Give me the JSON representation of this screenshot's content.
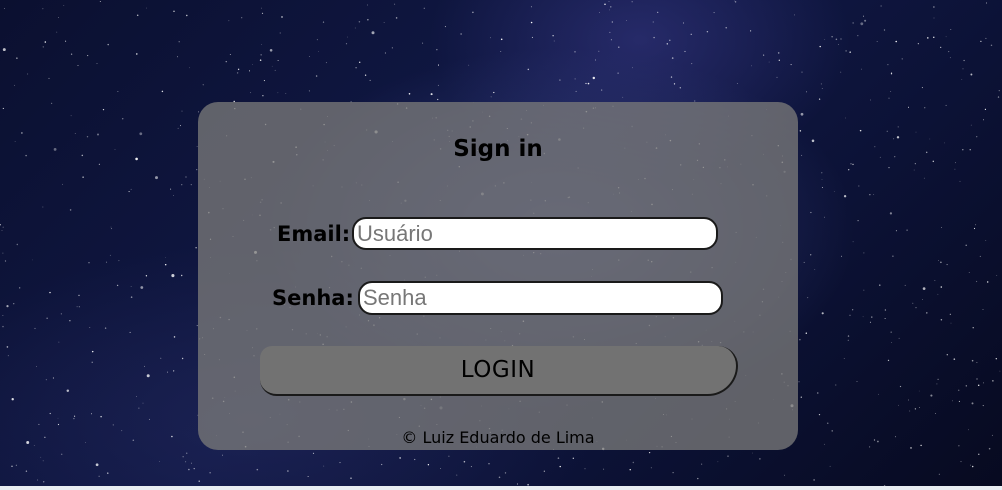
{
  "form": {
    "title": "Sign in",
    "email_label": "Email:",
    "email_placeholder": "Usuário",
    "password_label": "Senha:",
    "password_placeholder": "Senha",
    "login_label": "LOGIN"
  },
  "footer": {
    "credit": "© Luiz Eduardo de Lima"
  },
  "colors": {
    "card": "#787878",
    "button": "#727272",
    "background": "#0b1030"
  }
}
